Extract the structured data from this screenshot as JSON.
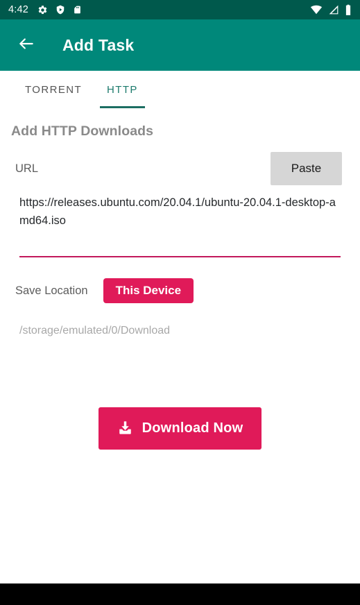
{
  "status_bar": {
    "clock": "4:42",
    "left_icons": [
      {
        "name": "settings-gear-icon"
      },
      {
        "name": "play-protect-shield-icon"
      },
      {
        "name": "sd-card-icon"
      }
    ],
    "right_icons": [
      {
        "name": "wifi-icon"
      },
      {
        "name": "cellular-signal-icon"
      },
      {
        "name": "battery-icon"
      }
    ],
    "background": "#00594C"
  },
  "app_bar": {
    "title": "Add Task",
    "back_icon": "arrow-left-icon",
    "background": "#00887A",
    "foreground": "#FFFFFF"
  },
  "tabs": {
    "items": [
      {
        "label": "TORRENT",
        "active": false
      },
      {
        "label": "HTTP",
        "active": true
      }
    ],
    "active_color": "#1C7A6C",
    "inactive_color": "#555555"
  },
  "main": {
    "section_title": "Add HTTP Downloads",
    "url": {
      "label": "URL",
      "value": "https://releases.ubuntu.com/20.04.1/ubuntu-20.04.1-desktop-amd64.iso",
      "placeholder": "URL",
      "underline_color": "#C2185B",
      "paste_label": "Paste"
    },
    "save_location": {
      "label": "Save Location",
      "button_label": "This Device",
      "path": "/storage/emulated/0/Download"
    },
    "download": {
      "label": "Download Now",
      "icon": "download-icon",
      "color": "#E01A59"
    }
  }
}
